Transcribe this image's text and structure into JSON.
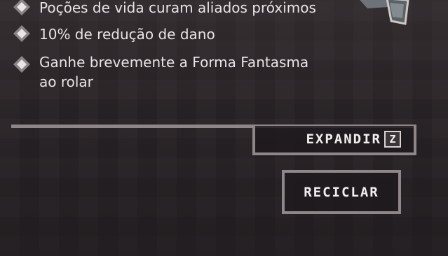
{
  "perks": [
    {
      "icon": "diamond-bullet-icon",
      "text": "Poções de vida curam aliados próximos"
    },
    {
      "icon": "diamond-bullet-icon",
      "text": "10% de redução de dano"
    },
    {
      "icon": "diamond-bullet-icon",
      "text": "Ganhe brevemente a Forma Fantasma\nao rolar"
    }
  ],
  "expand_button": {
    "label": "EXPANDIR",
    "key": "Z"
  },
  "recycle_button": {
    "label": "RECICLAR"
  },
  "colors": {
    "text": "#e8e3e4",
    "border": "#8e8689",
    "background": "#2a2427"
  }
}
